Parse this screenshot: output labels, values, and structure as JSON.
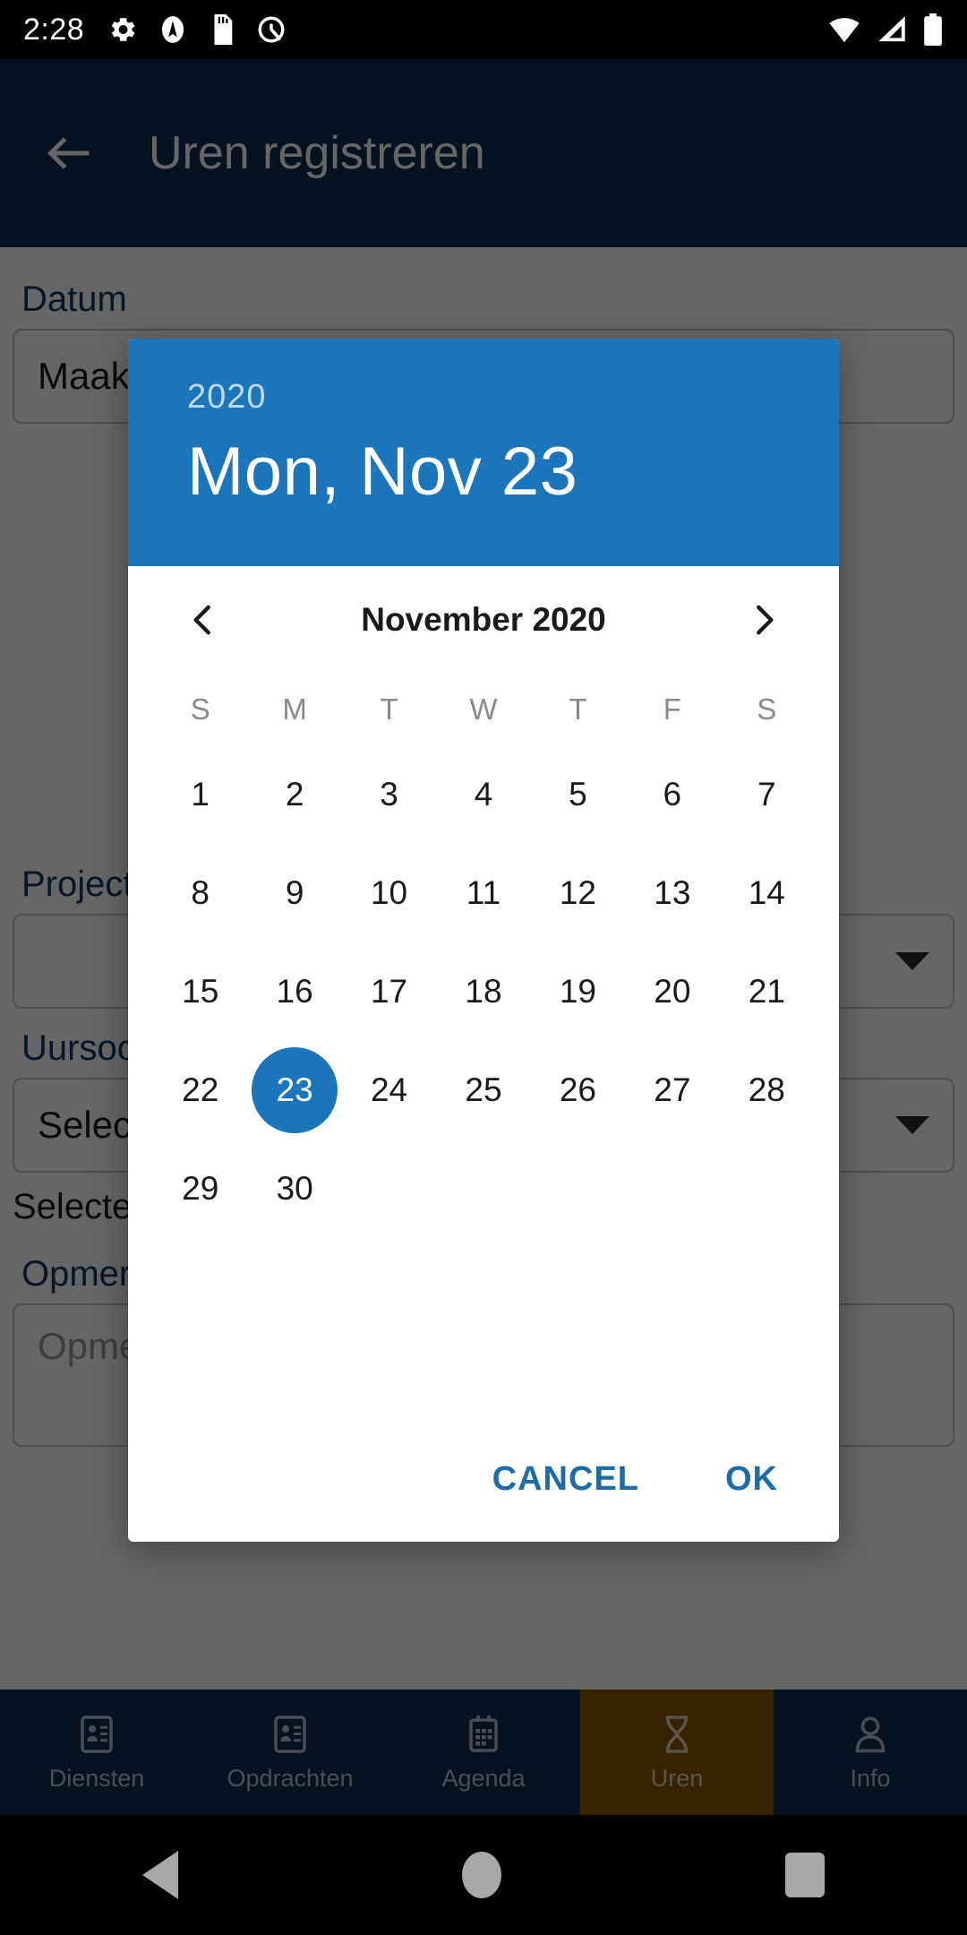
{
  "statusbar": {
    "time": "2:28",
    "left_icons": [
      "gear-icon",
      "adblock-icon",
      "sdcard-icon",
      "quick-settings-icon"
    ],
    "right_icons": [
      "wifi-icon",
      "cellular-signal-icon",
      "battery-icon"
    ]
  },
  "appbar": {
    "back_icon": "back-arrow-icon",
    "title": "Uren registreren"
  },
  "form": {
    "date_label": "Datum",
    "date_value": "Maak een keuze",
    "project_label": "Project",
    "project_value": "",
    "hourtype_label": "Uursoort",
    "hourtype_value": "Selecteer een uursoort",
    "hourtype_helper": "Selecteer een uursoort",
    "remark_label": "Opmerking",
    "remark_placeholder": "Opmerking"
  },
  "tabbar": {
    "items": [
      {
        "label": "Diensten",
        "icon": "contact-card-icon",
        "active": false
      },
      {
        "label": "Opdrachten",
        "icon": "contact-card-icon",
        "active": false
      },
      {
        "label": "Agenda",
        "icon": "calendar-icon",
        "active": false
      },
      {
        "label": "Uren",
        "icon": "hourglass-icon",
        "active": true
      },
      {
        "label": "Info",
        "icon": "person-icon",
        "active": false
      }
    ],
    "active_color": "#8a5608"
  },
  "dialog": {
    "year": "2020",
    "selected_date_long": "Mon, Nov 23",
    "header_color": "#1b75ba",
    "month_title": "November 2020",
    "prev_icon": "chevron-left-icon",
    "next_icon": "chevron-right-icon",
    "weekdays": [
      "S",
      "M",
      "T",
      "W",
      "T",
      "F",
      "S"
    ],
    "leading_blanks": 0,
    "days": [
      1,
      2,
      3,
      4,
      5,
      6,
      7,
      8,
      9,
      10,
      11,
      12,
      13,
      14,
      15,
      16,
      17,
      18,
      19,
      20,
      21,
      22,
      23,
      24,
      25,
      26,
      27,
      28,
      29,
      30
    ],
    "selected_day": 23,
    "cancel_label": "CANCEL",
    "ok_label": "OK",
    "action_color": "#1b6ca8"
  },
  "navbar": {
    "back": "back-triangle-icon",
    "home": "home-circle-icon",
    "recent": "recents-square-icon"
  }
}
